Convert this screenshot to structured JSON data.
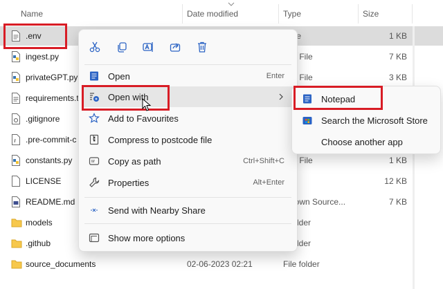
{
  "columns": {
    "name": "Name",
    "date": "Date modified",
    "type": "Type",
    "size": "Size"
  },
  "files": [
    {
      "name": ".env",
      "date": "",
      "type": "/ File",
      "size": "1 KB",
      "icon": "text-file-icon",
      "selected": true
    },
    {
      "name": "ingest.py",
      "date": "",
      "type": "hon File",
      "size": "7 KB",
      "icon": "python-file-icon"
    },
    {
      "name": "privateGPT.py",
      "date": "",
      "type": "hon File",
      "size": "3 KB",
      "icon": "python-file-icon"
    },
    {
      "name": "requirements.t",
      "date": "",
      "type": "",
      "size": "",
      "icon": "text-file-icon"
    },
    {
      "name": ".gitignore",
      "date": "",
      "type": "",
      "size": "",
      "icon": "gear-file-icon"
    },
    {
      "name": ".pre-commit-c",
      "date": "",
      "type": "",
      "size": "",
      "icon": "config-file-icon"
    },
    {
      "name": "constants.py",
      "date": "",
      "type": "hon File",
      "size": "1 KB",
      "icon": "python-file-icon"
    },
    {
      "name": "LICENSE",
      "date": "",
      "type": "",
      "size": "12 KB",
      "icon": "blank-file-icon"
    },
    {
      "name": "README.md",
      "date": "",
      "type": "rkdown Source...",
      "size": "7 KB",
      "icon": "markdown-file-icon"
    },
    {
      "name": "models",
      "date": "",
      "type": "e folder",
      "size": "",
      "icon": "folder-icon"
    },
    {
      "name": ".github",
      "date": "",
      "type": "e folder",
      "size": "",
      "icon": "folder-icon"
    },
    {
      "name": "source_documents",
      "date": "02-06-2023 02:21",
      "type": "File folder",
      "size": "",
      "icon": "folder-icon"
    }
  ],
  "context_menu": {
    "quick_actions": [
      {
        "name": "cut",
        "icon": "scissors-icon"
      },
      {
        "name": "copy",
        "icon": "copy-icon"
      },
      {
        "name": "rename",
        "icon": "rename-icon"
      },
      {
        "name": "share",
        "icon": "share-icon"
      },
      {
        "name": "delete",
        "icon": "trash-icon"
      }
    ],
    "items": [
      {
        "label": "Open",
        "shortcut": "Enter",
        "icon": "notepad-icon"
      },
      {
        "label": "Open with",
        "shortcut": "",
        "icon": "open-with-icon",
        "submenu": true
      },
      {
        "label": "Add to Favourites",
        "shortcut": "",
        "icon": "star-icon"
      },
      {
        "label": "Compress to postcode file",
        "shortcut": "",
        "icon": "zip-icon"
      },
      {
        "label": "Copy as path",
        "shortcut": "Ctrl+Shift+C",
        "icon": "path-icon"
      },
      {
        "label": "Properties",
        "shortcut": "Alt+Enter",
        "icon": "wrench-icon"
      },
      {
        "label": "Send with Nearby Share",
        "shortcut": "",
        "icon": "nearby-share-icon"
      },
      {
        "label": "Show more options",
        "shortcut": "",
        "icon": "more-options-icon"
      }
    ]
  },
  "submenu": {
    "items": [
      {
        "label": "Notepad",
        "icon": "notepad-icon"
      },
      {
        "label": "Search the Microsoft Store",
        "icon": "store-icon"
      },
      {
        "label": "Choose another app",
        "icon": ""
      }
    ]
  },
  "colors": {
    "highlight": "#d81c25",
    "accent": "#2b63c4",
    "selection": "#dcdcdc"
  }
}
